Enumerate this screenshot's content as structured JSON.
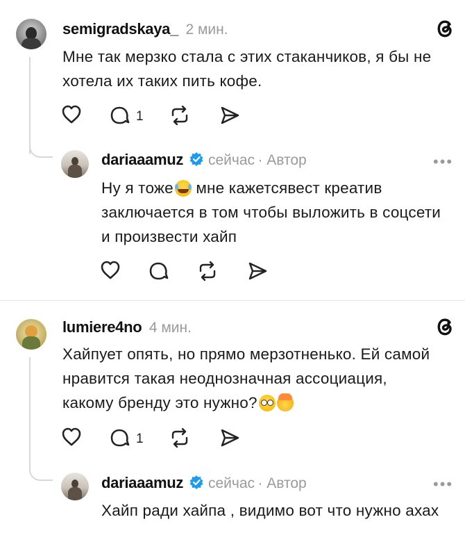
{
  "comments": [
    {
      "username": "semigradskaya_",
      "time": "2 мин.",
      "text": "Мне так мерзко стала с этих стаканчиков, я бы не хотела их таких пить кофе.",
      "reply_count": "1",
      "reply": {
        "username": "dariaaamuz",
        "time": "сейчас",
        "author_badge": "· Автор",
        "text_before_emoji": "Ну я тоже",
        "text_after_emoji": " мне кажетсявест креатив заключается в том чтобы выложить в соцсети и произвести хайп",
        "emoji": "😂",
        "more": "•••"
      }
    },
    {
      "username": "lumiere4no",
      "time": "4 мин.",
      "text": "Хайпует опять, но прямо мерзотненько. Ей самой нравится такая неоднозначная ассоциация, какому бренду это нужно?",
      "emojis": [
        "😳",
        "🤯"
      ],
      "reply_count": "1",
      "reply": {
        "username": "dariaaamuz",
        "time": "сейчас",
        "author_badge": "· Автор",
        "text": "Хайп ради хайпа , видимо вот что нужно ахах",
        "more": "•••"
      }
    }
  ],
  "colors": {
    "verified": "#1d9bf0",
    "muted": "#9a9a9a",
    "divider": "#e3e3e3"
  },
  "icons": [
    "threads-logo-icon",
    "heart-icon",
    "comment-icon",
    "repost-icon",
    "share-icon",
    "verified-badge-icon",
    "more-icon"
  ]
}
